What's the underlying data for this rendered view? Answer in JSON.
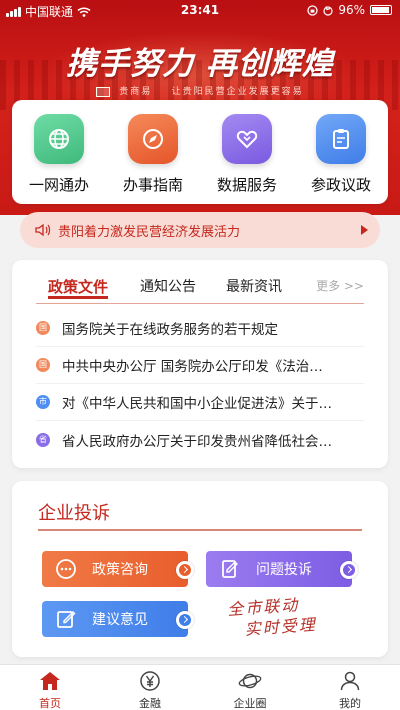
{
  "status_bar": {
    "carrier": "中国联通",
    "time": "23:41",
    "battery": "96%"
  },
  "banner": {
    "slogan": "携手努力 再创辉煌",
    "subline": "让贵阳民营企业发展更容易",
    "logo_text": "贵商易"
  },
  "services": [
    {
      "label": "一网通办",
      "icon": "globe-icon",
      "color": "#4cc58a"
    },
    {
      "label": "办事指南",
      "icon": "compass-icon",
      "color": "#ee6a38"
    },
    {
      "label": "数据服务",
      "icon": "handshake-icon",
      "color": "#8a6ce8"
    },
    {
      "label": "参政议政",
      "icon": "clipboard-icon",
      "color": "#4f8ef2"
    }
  ],
  "notice": {
    "text": "贵阳着力激发民营经济发展活力"
  },
  "news": {
    "tabs": [
      "政策文件",
      "通知公告",
      "最新资讯"
    ],
    "active_tab": "政策文件",
    "more": "更多 >>",
    "items": [
      {
        "title": "国务院关于在线政务服务的若干规定",
        "badge": "国",
        "color": "#f08a5d"
      },
      {
        "title": "中共中央办公厅 国务院办公厅印发《法治…",
        "badge": "国",
        "color": "#f08a5d"
      },
      {
        "title": "对《中华人民共和国中小企业促进法》关于…",
        "badge": "市",
        "color": "#4f8ef2"
      },
      {
        "title": "省人民政府办公厅关于印发贵州省降低社会…",
        "badge": "省",
        "color": "#8a6ce8"
      }
    ]
  },
  "complaint": {
    "title": "企业投诉",
    "actions": [
      {
        "label": "政策咨询",
        "icon": "chat-icon",
        "color": "#ee6a38"
      },
      {
        "label": "问题投诉",
        "icon": "edit-doc-icon",
        "color": "#8a6ce8"
      },
      {
        "label": "建议意见",
        "icon": "note-edit-icon",
        "color": "#4f8ef2"
      }
    ],
    "stamp_line1": "全市联动",
    "stamp_line2": "实时受理"
  },
  "tabbar": {
    "items": [
      {
        "label": "首页",
        "icon": "home-icon"
      },
      {
        "label": "金融",
        "icon": "yuan-icon"
      },
      {
        "label": "企业圈",
        "icon": "planet-icon"
      },
      {
        "label": "我的",
        "icon": "user-icon"
      }
    ],
    "active": "首页"
  },
  "colors": {
    "brand": "#c5281e",
    "banner": "#d4211b"
  }
}
